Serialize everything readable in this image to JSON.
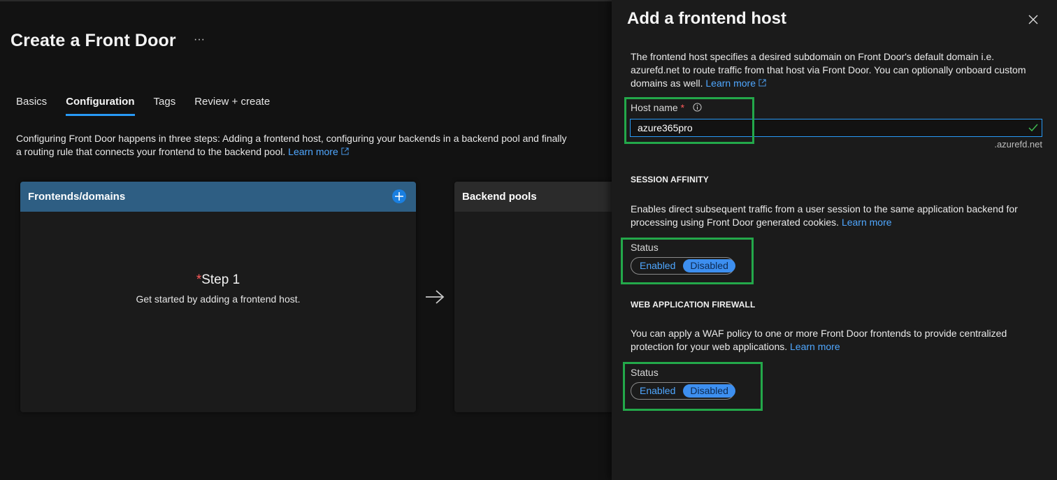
{
  "page": {
    "title": "Create a Front Door",
    "more": "···"
  },
  "tabs": [
    {
      "label": "Basics"
    },
    {
      "label": "Configuration",
      "active": true
    },
    {
      "label": "Tags"
    },
    {
      "label": "Review + create"
    }
  ],
  "description": {
    "text": "Configuring Front Door happens in three steps: Adding a frontend host, configuring your backends in a backend pool and finally a routing rule that connects your frontend to the backend pool.",
    "link": "Learn more"
  },
  "cards": {
    "frontends": {
      "title": "Frontends/domains",
      "step_star": "*",
      "step_title": "Step 1",
      "step_sub": "Get started by adding a frontend host."
    },
    "backend_pools": {
      "title": "Backend pools"
    }
  },
  "panel": {
    "title": "Add a frontend host",
    "intro": "The frontend host specifies a desired subdomain on Front Door's default domain i.e. azurefd.net to route traffic from that host via Front Door. You can optionally onboard custom domains as well.",
    "intro_link": "Learn more",
    "host_name": {
      "label": "Host name",
      "required": "*",
      "value": "azure365pro",
      "suffix": ".azurefd.net"
    },
    "session_affinity": {
      "heading": "SESSION AFFINITY",
      "text": "Enables direct subsequent traffic from a user session to the same application backend for processing using Front Door generated cookies.",
      "link": "Learn more",
      "status_label": "Status",
      "options": [
        "Enabled",
        "Disabled"
      ],
      "selected": "Disabled"
    },
    "waf": {
      "heading": "WEB APPLICATION FIREWALL",
      "text": "You can apply a WAF policy to one or more Front Door frontends to provide centralized protection for your web applications.",
      "link": "Learn more",
      "status_label": "Status",
      "options": [
        "Enabled",
        "Disabled"
      ],
      "selected": "Disabled"
    }
  },
  "colors": {
    "accent": "#2899f5",
    "link": "#4fa7ff",
    "highlight": "#23a84a",
    "card_header": "#2e5e83"
  },
  "icons": [
    "ellipsis-icon",
    "external-link-icon",
    "plus-icon",
    "arrow-right-icon",
    "close-icon",
    "info-icon",
    "checkmark-icon"
  ]
}
